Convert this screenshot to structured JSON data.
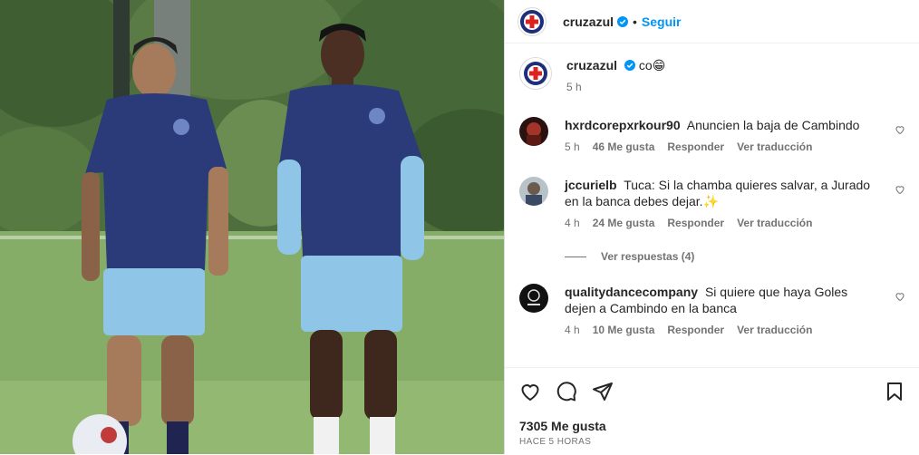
{
  "post": {
    "account": "cruzazul",
    "follow_label": "Seguir",
    "caption": "co",
    "caption_emoji": "😁",
    "caption_time": "5 h",
    "likes": "7305 Me gusta",
    "posted_ago": "HACE 5 HORAS"
  },
  "comments": [
    {
      "user": "hxrdcorepxrkour90",
      "text": "Anuncien la baja de Cambindo",
      "time": "5 h",
      "likes": "46 Me gusta",
      "reply": "Responder",
      "translate": "Ver traducción"
    },
    {
      "user": "jccurielb",
      "text": "Tuca: Si la chamba quieres salvar, a Jurado en la banca debes dejar.✨",
      "time": "4 h",
      "likes": "24 Me gusta",
      "reply": "Responder",
      "translate": "Ver traducción",
      "view_replies": "Ver respuestas (4)"
    },
    {
      "user": "qualitydancecompany",
      "text": "Si quiere que haya Goles dejen a Cambindo en la banca",
      "time": "4 h",
      "likes": "10 Me gusta",
      "reply": "Responder",
      "translate": "Ver traducción"
    }
  ],
  "icons": {
    "like": "heart-icon",
    "comment": "comment-icon",
    "share": "share-icon",
    "save": "bookmark-icon",
    "verified": "verified-badge-icon"
  },
  "colors": {
    "link": "#0095f6",
    "muted": "#737373",
    "jersey": "#2b3a78",
    "shorts": "#8fc5e6"
  }
}
